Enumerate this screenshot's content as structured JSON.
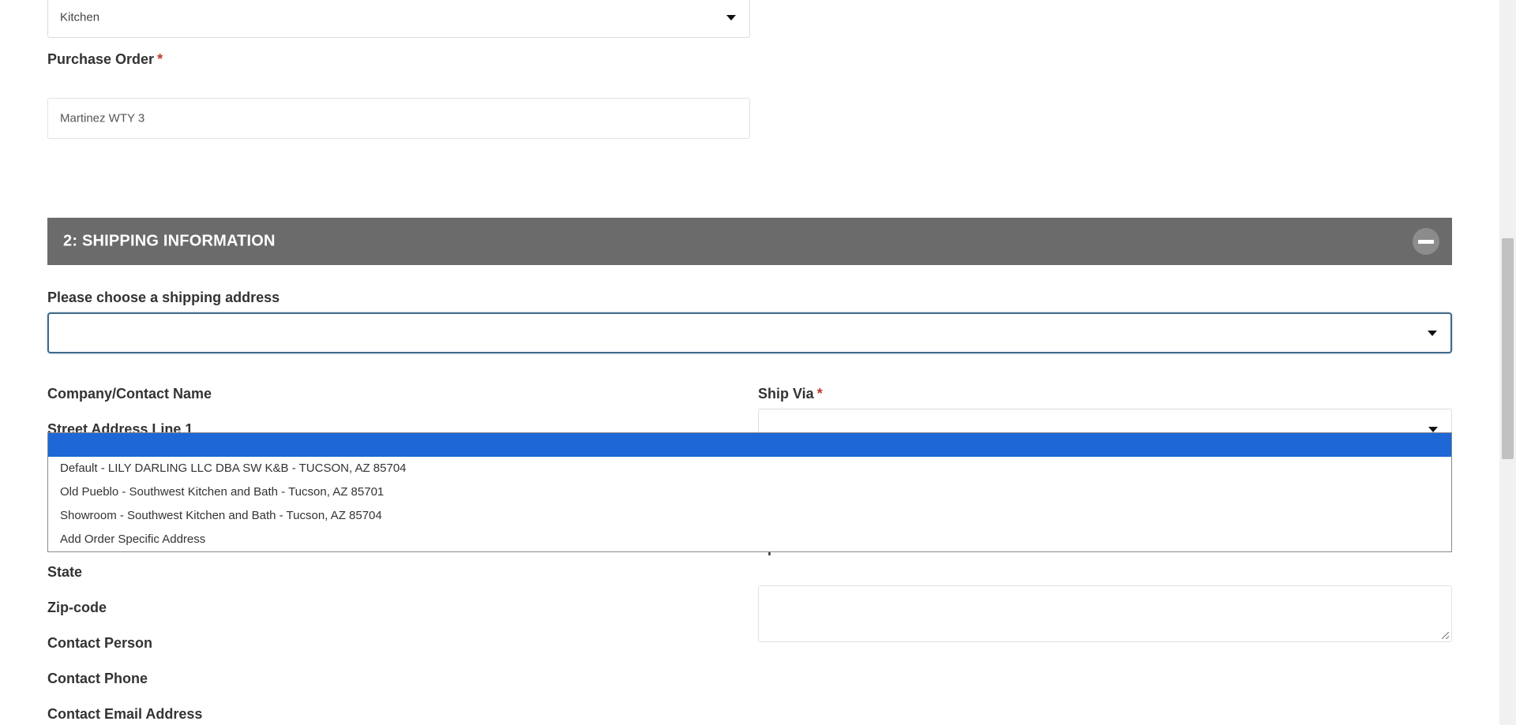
{
  "fields": {
    "room_select": {
      "value": "Kitchen"
    },
    "purchase_order": {
      "label": "Purchase Order",
      "required_mark": "*",
      "value": "Martinez WTY 3"
    }
  },
  "section": {
    "title": "2: SHIPPING INFORMATION"
  },
  "shipping": {
    "address_label": "Please choose a shipping address",
    "address_value": "",
    "address_options": [
      "",
      "Default - LILY DARLING LLC DBA SW K&B - TUCSON, AZ 85704",
      "Old Pueblo - Southwest Kitchen and Bath - Tucson, AZ 85701",
      "Showroom - Southwest Kitchen and Bath - Tucson, AZ 85704",
      "Add Order Specific Address"
    ],
    "left_labels": {
      "company": "Company/Contact Name",
      "street1": "Street Address Line 1",
      "state": "State",
      "zip": "Zip-code",
      "contact_person": "Contact Person",
      "contact_phone": "Contact Phone",
      "contact_email": "Contact Email Address"
    },
    "ship_via": {
      "label": "Ship Via",
      "required_mark": "*",
      "value": ""
    },
    "special_instructions": {
      "label": "Special Instructions",
      "value": ""
    }
  },
  "colors": {
    "section_header_bg": "#6b6b6b",
    "dropdown_highlight": "#1e67d6",
    "required": "#c0392b",
    "focus_border": "#3f6a8a"
  },
  "icons": {
    "caret": "chevron-down-icon",
    "collapse": "minus-circle-icon",
    "resize": "resize-grip-icon"
  }
}
